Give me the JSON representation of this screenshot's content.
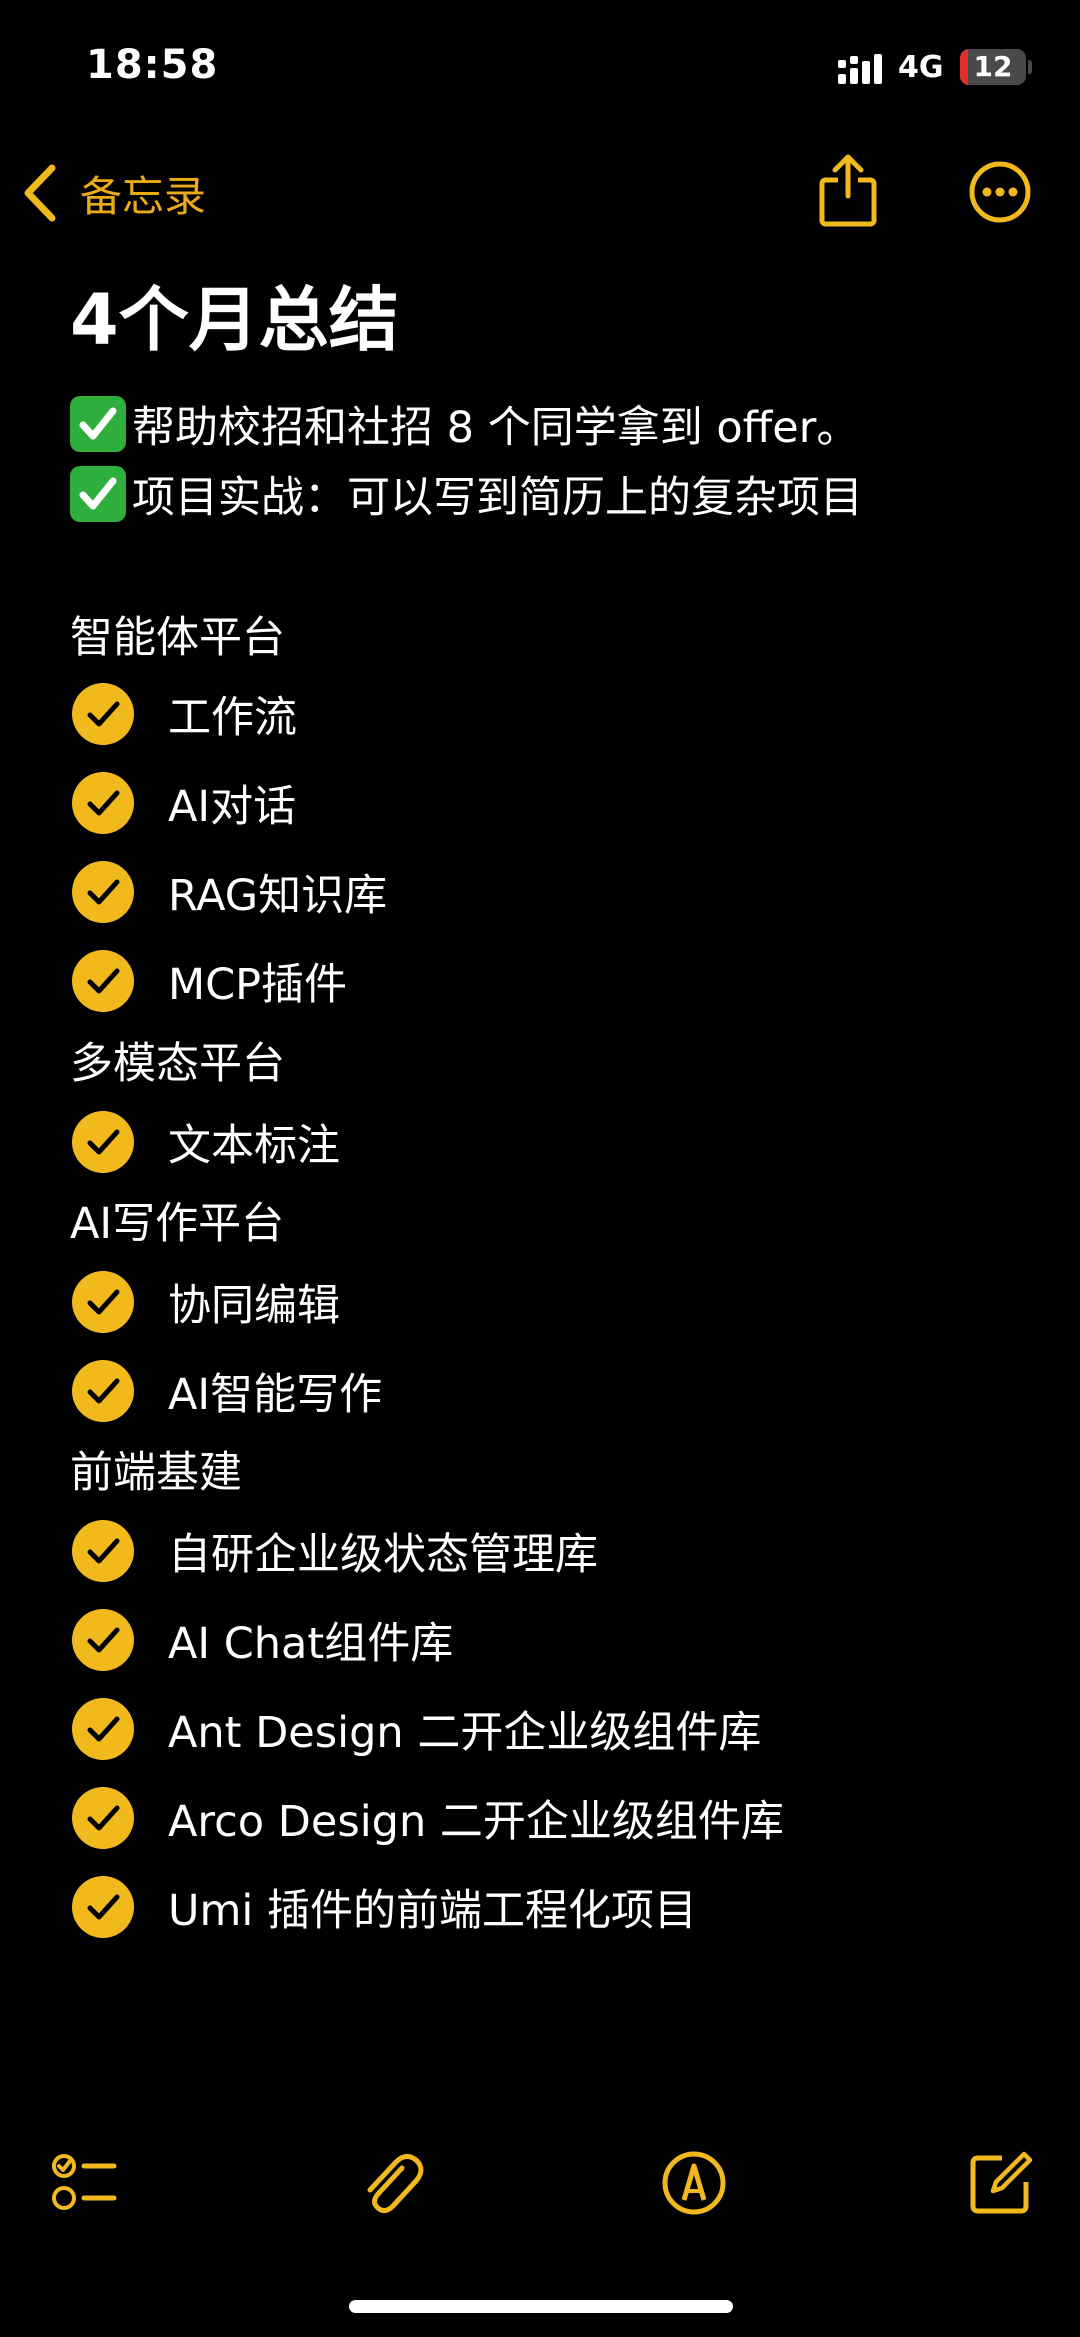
{
  "status_bar": {
    "time": "18:58",
    "network": "4G",
    "battery_level": "12",
    "battery_fraction": 0.12
  },
  "nav": {
    "back_label": "备忘录",
    "back_icon": "chevron-left-icon",
    "share_icon": "share-icon",
    "more_icon": "ellipsis-circle-icon"
  },
  "note": {
    "title": "4个月总结",
    "summary": [
      "帮助校招和社招 8 个同学拿到 offer。",
      "项目实战：可以写到简历上的复杂项目"
    ],
    "sections": [
      {
        "heading": "智能体平台",
        "items": [
          "工作流",
          "AI对话",
          "RAG知识库",
          "MCP插件"
        ]
      },
      {
        "heading": "多模态平台",
        "items": [
          "文本标注"
        ]
      },
      {
        "heading": "AI写作平台",
        "items": [
          "协同编辑",
          "AI智能写作"
        ]
      },
      {
        "heading": "前端基建",
        "items": [
          "自研企业级状态管理库",
          "AI Chat组件库",
          "Ant Design 二开企业级组件库",
          "Arco Design 二开企业级组件库",
          "Umi 插件的前端工程化项目"
        ]
      }
    ]
  },
  "toolbar": {
    "checklist_icon": "checklist-icon",
    "attachment_icon": "paperclip-icon",
    "markup_icon": "pen-circle-icon",
    "compose_icon": "compose-icon"
  },
  "colors": {
    "accent": "#f2b91d",
    "background": "#000000",
    "text": "#ffffff",
    "emoji_check": "#2eae3c",
    "battery_low": "#e0302c"
  }
}
